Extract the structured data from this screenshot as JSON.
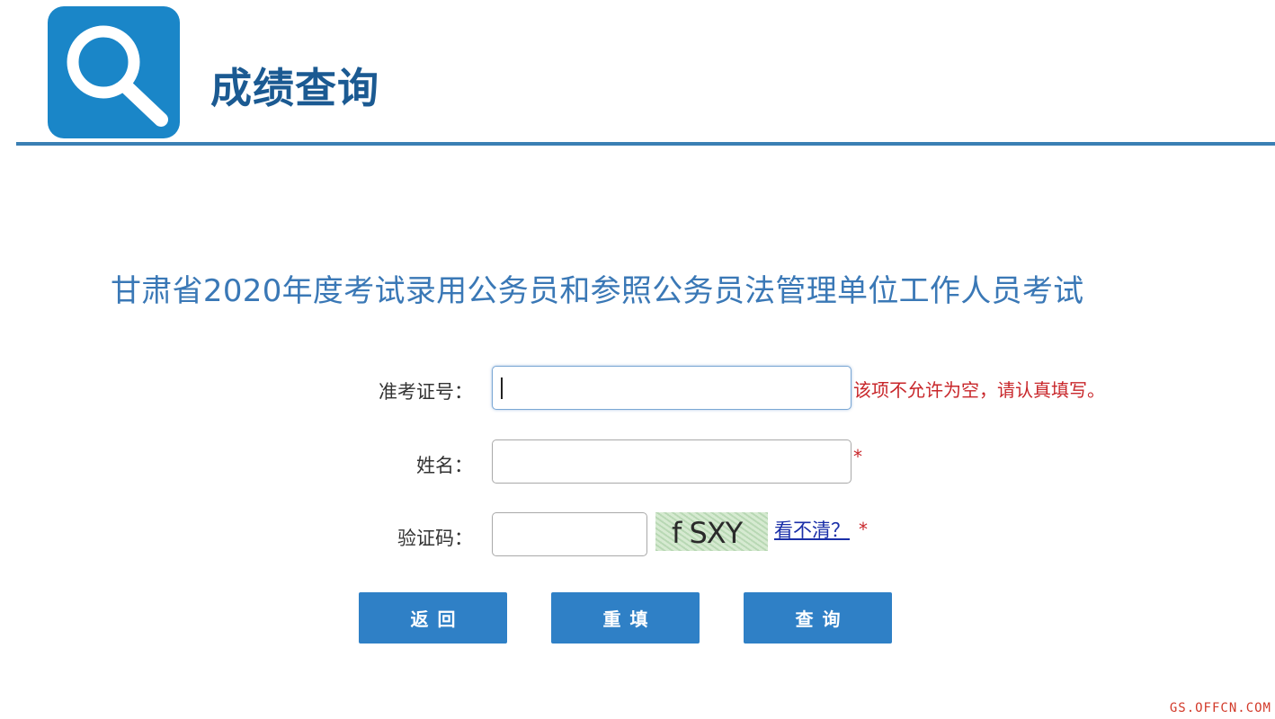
{
  "header": {
    "title": "成绩查询",
    "logo_icon": "search-icon",
    "accent_color": "#1a86c8"
  },
  "exam": {
    "title": "甘肃省2020年度考试录用公务员和参照公务员法管理单位工作人员考试"
  },
  "form": {
    "admission_label": "准考证号：",
    "admission_value": "",
    "admission_error": "该项不允许为空，请认真填写。",
    "name_label": "姓名：",
    "name_value": "",
    "name_required": "*",
    "captcha_label": "验证码：",
    "captcha_value": "",
    "captcha_text": "f SXY",
    "captcha_refresh": "看不清？",
    "captcha_required": "*"
  },
  "buttons": {
    "back": "返回",
    "reset": "重填",
    "query": "查询"
  },
  "watermark": "GS.OFFCN.COM",
  "colors": {
    "button": "#2f80c6",
    "error": "#c8262a",
    "title": "#1b5a92"
  }
}
